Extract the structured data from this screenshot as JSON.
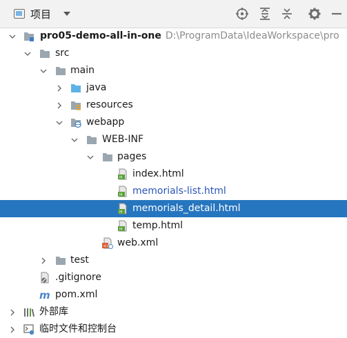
{
  "toolbar": {
    "view_label": "项目",
    "view_icon": "project-view-icon",
    "dropdown_icon": "chevron-down-icon",
    "buttons": [
      "locate-icon",
      "expand-all-icon",
      "collapse-all-icon",
      "settings-gear-icon",
      "hide-minus-icon"
    ]
  },
  "tree": {
    "root": {
      "name": "pro05-demo-all-in-one",
      "path": "D:\\ProgramData\\IdeaWorkspace\\pro"
    },
    "src": "src",
    "main": "main",
    "java": "java",
    "resources": "resources",
    "webapp": "webapp",
    "webinf": "WEB-INF",
    "pages": "pages",
    "index": "index.html",
    "memorials_list": "memorials-list.html",
    "memorials_detail": "memorials_detail.html",
    "temp": "temp.html",
    "webxml": "web.xml",
    "test": "test",
    "gitignore": ".gitignore",
    "pom": "pom.xml",
    "external_libs": "外部库",
    "scratches": "临时文件和控制台"
  },
  "colors": {
    "selection": "#2675bf",
    "modified_file": "#2b55b8",
    "folder": "#9aa7b0",
    "source_folder": "#5fb2e5",
    "html_badge": "#5a9e3a",
    "xml_badge": "#d7623c"
  }
}
